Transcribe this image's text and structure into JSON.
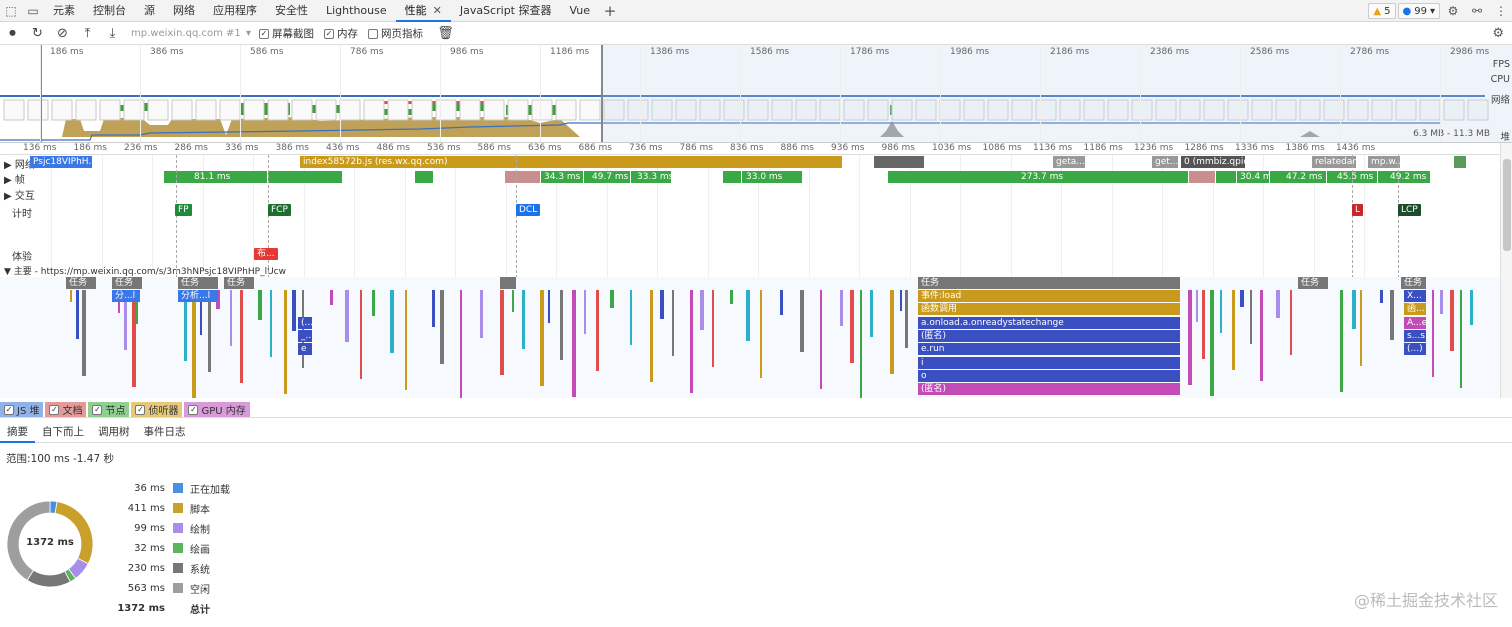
{
  "tabs": [
    "元素",
    "控制台",
    "源",
    "网络",
    "应用程序",
    "安全性",
    "Lighthouse",
    "性能",
    "JavaScript 探查器",
    "Vue"
  ],
  "active_tab": "性能",
  "badges": {
    "warnings": "5",
    "issues": "99"
  },
  "toolbar": {
    "profile_select": "mp.weixin.qq.com #1",
    "screenshots_label": "屏幕截图",
    "memory_label": "内存",
    "web_vitals_label": "网页指标"
  },
  "overview": {
    "ticks": [
      "186 ms",
      "386 ms",
      "586 ms",
      "786 ms",
      "986 ms",
      "1186 ms",
      "1386 ms",
      "1586 ms",
      "1786 ms",
      "1986 ms",
      "2186 ms",
      "2386 ms",
      "2586 ms",
      "2786 ms",
      "2986 ms",
      "3186 ms",
      "3386 ms"
    ],
    "labels": {
      "fps": "FPS",
      "cpu": "CPU",
      "net": "网络",
      "heap": "堆"
    },
    "heap_range": "6.3 MB - 11.3 MB"
  },
  "ruler": [
    "136 ms",
    "186 ms",
    "236 ms",
    "286 ms",
    "336 ms",
    "386 ms",
    "436 ms",
    "486 ms",
    "536 ms",
    "586 ms",
    "636 ms",
    "686 ms",
    "736 ms",
    "786 ms",
    "836 ms",
    "886 ms",
    "936 ms",
    "986 ms",
    "1036 ms",
    "1086 ms",
    "1136 ms",
    "1186 ms",
    "1236 ms",
    "1286 ms",
    "1336 ms",
    "1386 ms",
    "1436 ms"
  ],
  "tracks": {
    "network": "网络",
    "frames": "帧",
    "interactions": "交互",
    "timings": "计时",
    "experience": "体验",
    "main": "主要 - https://mp.weixin.qq.com/s/3m3hNPsjc18VIPhHP_lUcw"
  },
  "network_bars": [
    {
      "label": "Psjc18VIPhH...",
      "color": "#3b78e7"
    },
    {
      "label": "index58572b.js (res.wx.qq.com)",
      "color": "#c99a1c"
    },
    {
      "label": "geta...",
      "color": "#999"
    },
    {
      "label": "get...",
      "color": "#999"
    },
    {
      "label": "0 (mmbiz.qpic 640",
      "color": "#666"
    },
    {
      "label": "relatedarti...",
      "color": "#999"
    },
    {
      "label": "mp.w...",
      "color": "#999"
    }
  ],
  "frames": [
    "81.1 ms",
    "34.3 ms",
    "49.7 ms",
    "33.3 ms",
    "33.0 ms",
    "273.7 ms",
    "30.4 ms",
    "47.2 ms",
    "45.5 ms",
    "49.2 ms"
  ],
  "timings": [
    "FP",
    "FCP",
    "DCL",
    "L",
    "LCP"
  ],
  "experience": "布...",
  "flame": {
    "task": "任务",
    "short1": "分...l",
    "short2": "分析...l",
    "event_load": "事件:load",
    "function_call": "函数调用",
    "onload": "a.onload.a.onreadystatechange",
    "anon": "(匿名)",
    "erun": "e.run",
    "i": "i",
    "o": "o",
    "anon2": "(匿名)",
    "r1": "(...",
    "r2": "_...",
    "r3": "e",
    "x1": "X...",
    "x2": "函...",
    "x3": "A...e",
    "x4": "s...s",
    "x5": "(...)"
  },
  "memory": [
    "JS 堆",
    "文档",
    "节点",
    "侦听器",
    "GPU 内存"
  ],
  "subtabs": [
    "摘要",
    "自下而上",
    "调用树",
    "事件日志"
  ],
  "summary": {
    "range": "范围:100 ms -1.47 秒",
    "center": "1372 ms",
    "rows": [
      {
        "value": "36 ms",
        "label": "正在加载",
        "color": "#4a90e2",
        "amount": 36
      },
      {
        "value": "411 ms",
        "label": "脚本",
        "color": "#c9a02a",
        "amount": 411
      },
      {
        "value": "99 ms",
        "label": "绘制",
        "color": "#a88ee8",
        "amount": 99
      },
      {
        "value": "32 ms",
        "label": "绘画",
        "color": "#5eb35e",
        "amount": 32
      },
      {
        "value": "230 ms",
        "label": "系统",
        "color": "#777777",
        "amount": 230
      },
      {
        "value": "563 ms",
        "label": "空闲",
        "color": "#9e9e9e",
        "amount": 563
      }
    ],
    "total_value": "1372 ms",
    "total_label": "总计"
  },
  "watermark": "@稀土掘金技术社区"
}
